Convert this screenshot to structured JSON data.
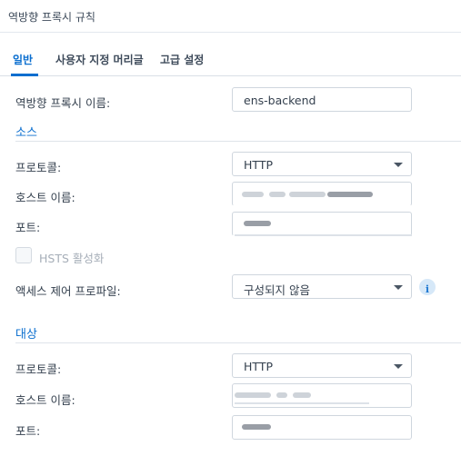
{
  "window": {
    "title": "역방향 프록시 규칙"
  },
  "tabs": [
    {
      "label": "일반",
      "active": true
    },
    {
      "label": "사용자 지정 머리글",
      "active": false
    },
    {
      "label": "고급 설정",
      "active": false
    }
  ],
  "general": {
    "name_label": "역방향 프록시 이름:",
    "name_value": "ens-backend"
  },
  "source": {
    "heading": "소스",
    "protocol_label": "프로토콜:",
    "protocol_value": "HTTP",
    "hostname_label": "호스트 이름:",
    "port_label": "포트:",
    "hsts_label": "HSTS 활성화",
    "access_label": "액세스 제어 프로파일:",
    "access_value": "구성되지 않음",
    "info_icon": "i"
  },
  "destination": {
    "heading": "대상",
    "protocol_label": "프로토콜:",
    "protocol_value": "HTTP",
    "hostname_label": "호스트 이름:",
    "port_label": "포트:"
  },
  "colors": {
    "accent": "#0a6ecf",
    "text": "#333f4d",
    "border": "#cfd6de"
  }
}
